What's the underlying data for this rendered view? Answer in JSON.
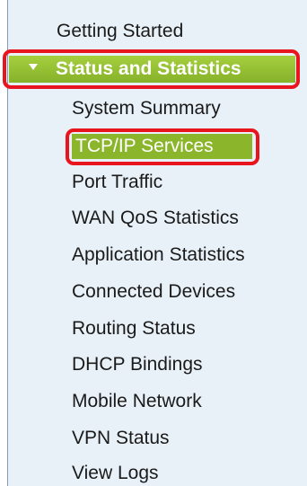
{
  "nav": {
    "top_item": "Getting Started",
    "section": {
      "label": "Status and Statistics",
      "expanded": true,
      "accent_color": "#96c033",
      "highlight_color": "#e8141e"
    },
    "items": [
      {
        "label": "System Summary",
        "active": false
      },
      {
        "label": "TCP/IP Services",
        "active": true
      },
      {
        "label": "Port Traffic",
        "active": false
      },
      {
        "label": "WAN QoS Statistics",
        "active": false
      },
      {
        "label": "Application Statistics",
        "active": false
      },
      {
        "label": "Connected Devices",
        "active": false
      },
      {
        "label": "Routing Status",
        "active": false
      },
      {
        "label": "DHCP Bindings",
        "active": false
      },
      {
        "label": "Mobile Network",
        "active": false
      },
      {
        "label": "VPN Status",
        "active": false
      },
      {
        "label": "View Logs",
        "active": false
      }
    ]
  }
}
